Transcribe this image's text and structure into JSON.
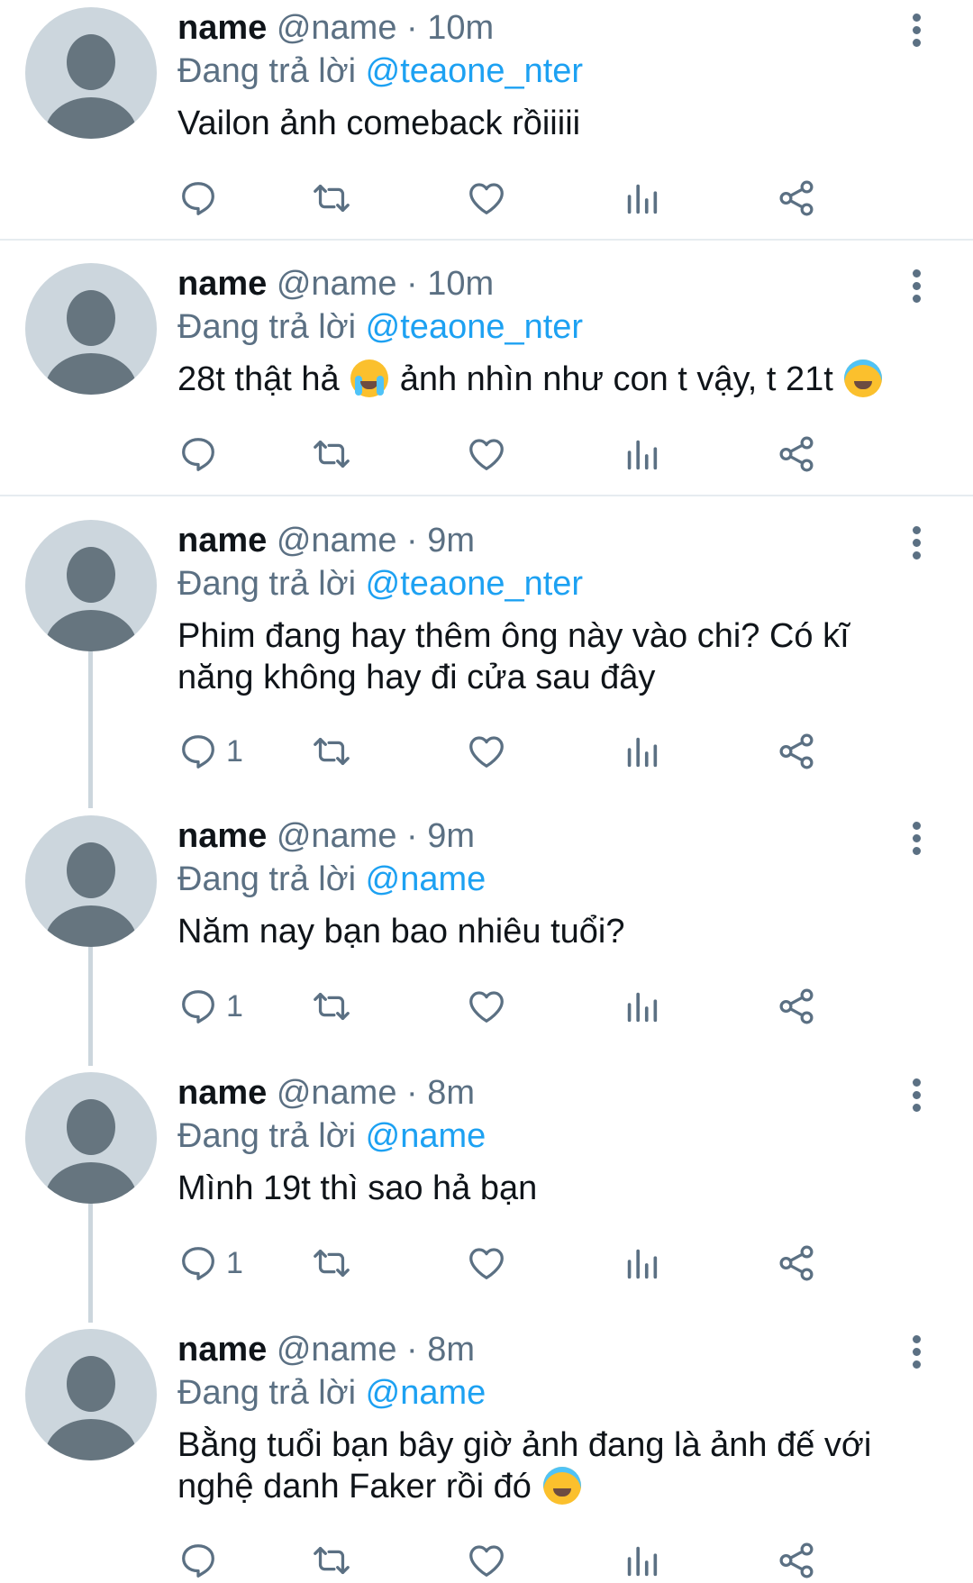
{
  "tweets": [
    {
      "name": "name",
      "handle": "@name",
      "dot": " · ",
      "time": "10m",
      "reply_prefix": "Đang trả lời ",
      "reply_to": "@teaone_nter",
      "text_parts": [
        "Vailon ảnh comeback rồiiiii"
      ],
      "reply_count": ""
    },
    {
      "name": "name",
      "handle": "@name",
      "dot": " · ",
      "time": "10m",
      "reply_prefix": "Đang trả lời ",
      "reply_to": "@teaone_nter",
      "text_parts": [
        "28t thật hả ",
        "ảnh nhìn như con t vậy, t 21t "
      ],
      "emojis": [
        "loudly-crying-face-icon",
        "smiling-face-with-halo-icon"
      ],
      "reply_count": ""
    },
    {
      "name": "name",
      "handle": "@name",
      "dot": " · ",
      "time": "9m",
      "reply_prefix": "Đang trả lời ",
      "reply_to": "@teaone_nter",
      "text_parts": [
        "Phim đang hay thêm ông này vào chi? Có kĩ năng không hay đi cửa sau đây"
      ],
      "reply_count": "1"
    },
    {
      "name": "name",
      "handle": "@name",
      "dot": " · ",
      "time": "9m",
      "reply_prefix": "Đang trả lời ",
      "reply_to": "@name",
      "text_parts": [
        "Năm nay bạn bao nhiêu tuổi?"
      ],
      "reply_count": "1"
    },
    {
      "name": "name",
      "handle": "@name",
      "dot": " · ",
      "time": "8m",
      "reply_prefix": "Đang trả lời ",
      "reply_to": "@name",
      "text_parts": [
        "Mình 19t thì sao hả bạn"
      ],
      "reply_count": "1"
    },
    {
      "name": "name",
      "handle": "@name",
      "dot": " · ",
      "time": "8m",
      "reply_prefix": "Đang trả lời ",
      "reply_to": "@name",
      "text_parts": [
        "Bằng tuổi bạn bây giờ ảnh đang là ảnh đế với nghệ danh Faker rồi đó "
      ],
      "emojis": [
        "smiling-face-with-halo-icon"
      ],
      "reply_count": ""
    }
  ],
  "colors": {
    "text": "#0f1419",
    "secondary": "#5b7083",
    "link": "#1da1f2",
    "avatar_bg": "#ccd6dd",
    "avatar_fg": "#66757f",
    "divider": "#e6ecf0"
  },
  "icons": [
    "reply-icon",
    "retweet-icon",
    "like-icon",
    "analytics-icon",
    "share-icon",
    "more-options-icon"
  ]
}
